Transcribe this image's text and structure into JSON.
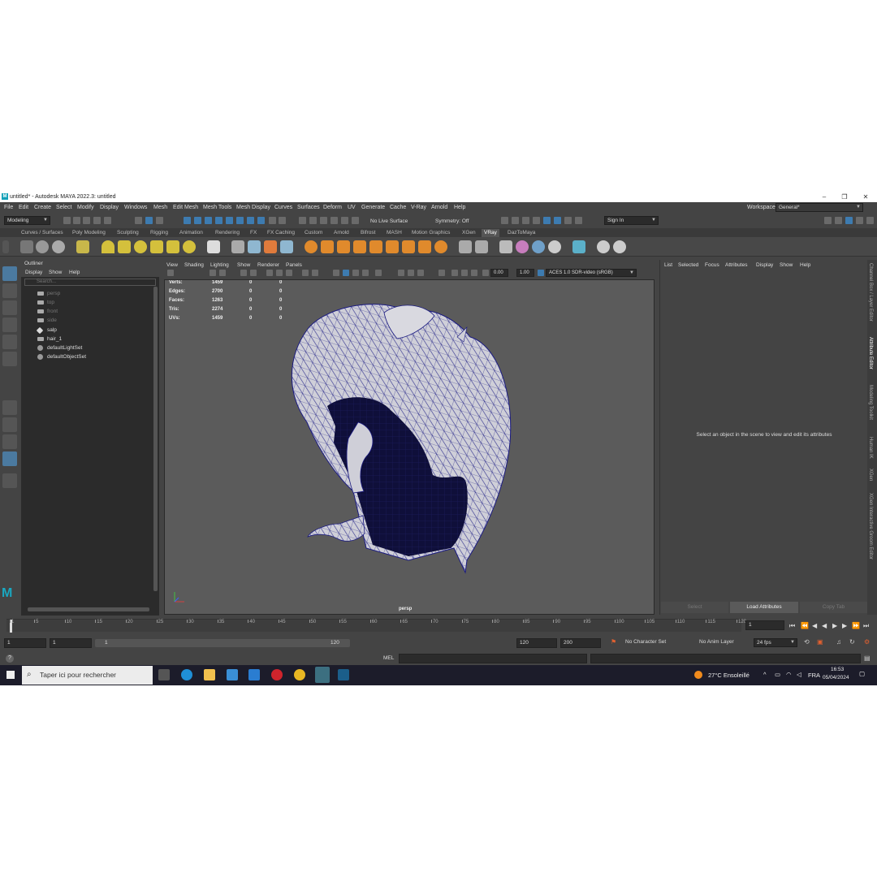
{
  "window": {
    "title": "untitled* - Autodesk MAYA 2022.3: untitled",
    "logo": "M"
  },
  "menubar": {
    "items": [
      "File",
      "Edit",
      "Create",
      "Select",
      "Modify",
      "Display",
      "Windows",
      "Mesh",
      "Edit Mesh",
      "Mesh Tools",
      "Mesh Display",
      "Curves",
      "Surfaces",
      "Deform",
      "UV",
      "Generate",
      "Cache",
      "V-Ray",
      "Arnold",
      "Help"
    ],
    "workspace_label": "Workspace:",
    "workspace_value": "General*"
  },
  "statusline": {
    "mode": "Modeling",
    "live_surface": "No Live Surface",
    "symmetry": "Symmetry: Off",
    "sign_in": "Sign In"
  },
  "shelf": {
    "tabs": [
      "Curves / Surfaces",
      "Poly Modeling",
      "Sculpting",
      "Rigging",
      "Animation",
      "Rendering",
      "FX",
      "FX Caching",
      "Custom",
      "Arnold",
      "Bifrost",
      "MASH",
      "Motion Graphics",
      "XGen",
      "VRay",
      "DazToMaya"
    ],
    "active_tab": "VRay"
  },
  "outliner": {
    "title": "Outliner",
    "menu": [
      "Display",
      "Show",
      "Help"
    ],
    "search_placeholder": "Search...",
    "items": [
      {
        "label": "persp",
        "dim": true,
        "icon": "camera-icon"
      },
      {
        "label": "top",
        "dim": true,
        "icon": "camera-icon"
      },
      {
        "label": "front",
        "dim": true,
        "icon": "camera-icon"
      },
      {
        "label": "side",
        "dim": true,
        "icon": "camera-icon"
      },
      {
        "label": "salp",
        "dim": false,
        "icon": "transform-icon"
      },
      {
        "label": "hair_1",
        "dim": false,
        "icon": "camera-icon"
      },
      {
        "label": "defaultLightSet",
        "dim": false,
        "icon": "set-icon"
      },
      {
        "label": "defaultObjectSet",
        "dim": false,
        "icon": "set-icon"
      }
    ]
  },
  "viewport": {
    "menu": [
      "View",
      "Shading",
      "Lighting",
      "Show",
      "Renderer",
      "Panels"
    ],
    "exposure": "0.00",
    "gamma": "1.00",
    "color_space": "ACES 1.0 SDR-video (sRGB)",
    "camera": "persp",
    "hud": [
      {
        "label": "Verts:",
        "v1": "1459",
        "v2": "0",
        "v3": "0"
      },
      {
        "label": "Edges:",
        "v1": "2700",
        "v2": "0",
        "v3": "0"
      },
      {
        "label": "Faces:",
        "v1": "1263",
        "v2": "0",
        "v3": "0"
      },
      {
        "label": "Tris:",
        "v1": "2274",
        "v2": "0",
        "v3": "0"
      },
      {
        "label": "UVs:",
        "v1": "1459",
        "v2": "0",
        "v3": "0"
      }
    ]
  },
  "attribute_editor": {
    "menu": [
      "List",
      "Selected",
      "Focus",
      "Attributes",
      "Display",
      "Show",
      "Help"
    ],
    "message": "Select an object in the scene to view and edit its attributes",
    "buttons": [
      "Select",
      "Load Attributes",
      "Copy Tab"
    ]
  },
  "side_tabs": [
    "Channel Box / Layer Editor",
    "Attribute Editor",
    "Modeling Toolkit",
    "Human IK",
    "XGen",
    "XGen Interactive Groom Editor"
  ],
  "timeline": {
    "ticks": [
      "1",
      "5",
      "10",
      "15",
      "20",
      "25",
      "30",
      "35",
      "40",
      "45",
      "50",
      "55",
      "60",
      "65",
      "70",
      "75",
      "80",
      "85",
      "90",
      "95",
      "100",
      "105",
      "110",
      "115",
      "120"
    ],
    "current_frame": "1"
  },
  "range": {
    "start": "1",
    "anim_start": "1",
    "slider_start": "1",
    "slider_end": "120",
    "anim_end": "120",
    "end": "200",
    "character_set": "No Character Set",
    "anim_layer": "No Anim Layer",
    "fps": "24 fps"
  },
  "cmdline": {
    "label": "MEL"
  },
  "taskbar": {
    "search_placeholder": "Taper ici pour rechercher",
    "weather": "27°C  Ensoleillé",
    "lang": "FRA",
    "time": "16:53",
    "date": "05/04/2024"
  },
  "colors": {
    "accent": "#4b7aa0",
    "viewport_bg": "#5b5b5b",
    "wire": "#1a1a80"
  }
}
